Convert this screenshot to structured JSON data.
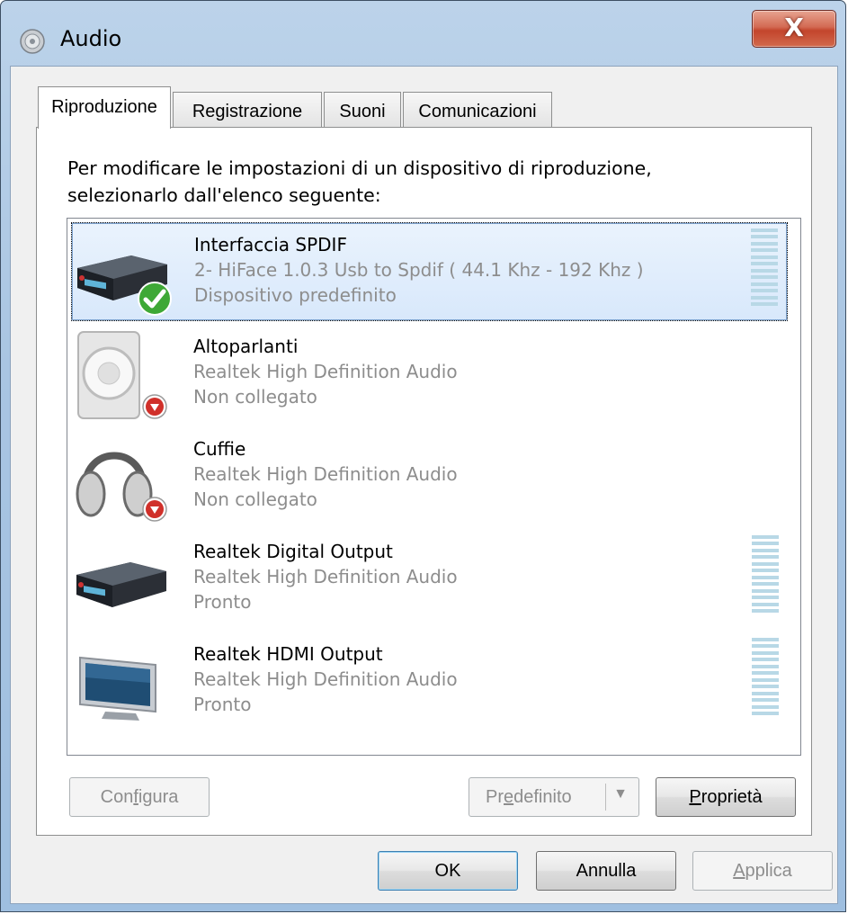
{
  "window": {
    "title": "Audio",
    "close_label": "X"
  },
  "tabs": [
    {
      "label": "Riproduzione",
      "active": true
    },
    {
      "label": "Registrazione",
      "active": false
    },
    {
      "label": "Suoni",
      "active": false
    },
    {
      "label": "Comunicazioni",
      "active": false
    }
  ],
  "panel": {
    "instruction_line1": "Per modificare le impostazioni di un dispositivo di riproduzione,",
    "instruction_line2": "selezionarlo dall'elenco seguente:"
  },
  "devices": [
    {
      "name": "Interfaccia SPDIF",
      "description": "2- HiFace 1.0.3 Usb to Spdif ( 44.1 Khz - 192 Khz )",
      "status": "Dispositivo predefinito",
      "icon": "digital-output-device-icon",
      "badge": "default-check-icon",
      "selected": true,
      "has_meter": true
    },
    {
      "name": "Altoparlanti",
      "description": "Realtek High Definition Audio",
      "status": "Non collegato",
      "icon": "speaker-icon",
      "badge": "unplugged-icon",
      "selected": false,
      "has_meter": false
    },
    {
      "name": "Cuffie",
      "description": "Realtek High Definition Audio",
      "status": "Non collegato",
      "icon": "headphones-icon",
      "badge": "unplugged-icon",
      "selected": false,
      "has_meter": false
    },
    {
      "name": "Realtek Digital Output",
      "description": "Realtek High Definition Audio",
      "status": "Pronto",
      "icon": "digital-output-device-icon",
      "badge": "",
      "selected": false,
      "has_meter": true
    },
    {
      "name": "Realtek HDMI Output",
      "description": "Realtek High Definition Audio",
      "status": "Pronto",
      "icon": "monitor-icon",
      "badge": "",
      "selected": false,
      "has_meter": true
    }
  ],
  "panel_buttons": {
    "configure": {
      "before": "Con",
      "mnemonic": "f",
      "after": "igura",
      "enabled": false
    },
    "set_default": {
      "before": "Pr",
      "mnemonic": "e",
      "after": "definito",
      "enabled": false
    },
    "properties": {
      "before": "",
      "mnemonic": "P",
      "after": "roprietà",
      "enabled": true
    }
  },
  "dialog_buttons": {
    "ok": "OK",
    "cancel": "Annulla",
    "apply": {
      "before": "",
      "mnemonic": "A",
      "after": "pplica",
      "enabled": false
    }
  },
  "colors": {
    "selection": "#d8e8fb",
    "meter": "#b8d8e6",
    "check": "#3ea836",
    "unplugged": "#d0302a"
  }
}
